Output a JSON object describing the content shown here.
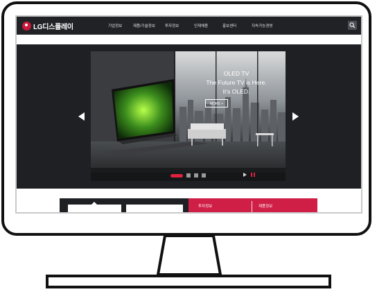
{
  "brand": {
    "name": "LG디스플레이",
    "color": "#c9183b"
  },
  "nav": {
    "items": [
      "기업정보",
      "제품/기술정보",
      "투자정보",
      "인재채용",
      "홍보센터",
      "지속가능경영"
    ]
  },
  "hero": {
    "title_lines": [
      "OLED TV",
      "The Future TV is Here.",
      "It's OLED."
    ],
    "more_label": "MORE +",
    "slide_count": 4,
    "active_slide": 1
  },
  "lower": {
    "red_labels": [
      "투자정보",
      "제품정보"
    ]
  },
  "colors": {
    "accent": "#e0213f",
    "nav_bg": "#202226",
    "panel_red": "#d01f47"
  },
  "icons": [
    "search-icon",
    "chevron-left-icon",
    "chevron-right-icon",
    "play-icon",
    "pause-icon",
    "lg-logo-icon"
  ]
}
